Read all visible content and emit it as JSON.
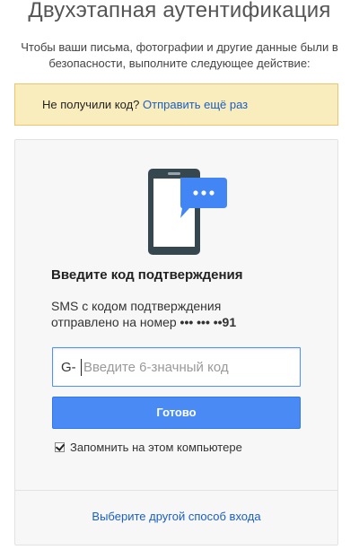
{
  "page": {
    "title": "Двухэтапная аутентификация",
    "subtitle": "Чтобы ваши письма, фотографии и другие данные были в безопасности, выполните следующее действие:"
  },
  "notice": {
    "text": "Не получили код?",
    "link": "Отправить ещё раз"
  },
  "card": {
    "icon": "phone-sms-icon",
    "heading": "Введите код подтверждения",
    "sms_line1": "SMS с кодом подтверждения",
    "sms_line2": "отправлено на номер",
    "phone_masked": "••• ••• ••91",
    "code_prefix": "G-",
    "code_value": "",
    "code_placeholder": "Введите 6-значный код",
    "submit_label": "Готово",
    "remember_label": "Запомнить на этом компьютере",
    "remember_checked": true,
    "other_method_link": "Выберите другой способ входа"
  },
  "colors": {
    "accent": "#4a8af4",
    "link": "#1a5fc4",
    "notice_bg": "#f9edbe",
    "phone_body": "#37474f",
    "bubble": "#4285f4"
  }
}
